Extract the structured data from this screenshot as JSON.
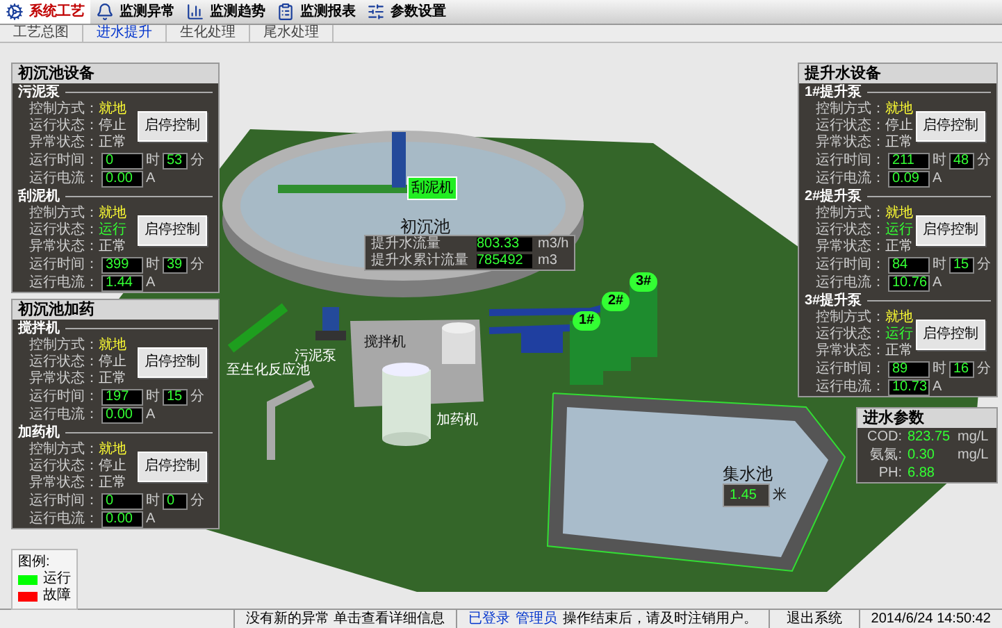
{
  "menu": [
    {
      "label": "系统工艺",
      "selected": true
    },
    {
      "label": "监测异常",
      "selected": false
    },
    {
      "label": "监测趋势",
      "selected": false
    },
    {
      "label": "监测报表",
      "selected": false
    },
    {
      "label": "参数设置",
      "selected": false
    }
  ],
  "subtabs": [
    {
      "label": "工艺总图",
      "selected": false
    },
    {
      "label": "进水提升",
      "selected": true
    },
    {
      "label": "生化处理",
      "selected": false
    },
    {
      "label": "尾水处理",
      "selected": false
    }
  ],
  "panels": [
    {
      "title": "初沉池设备",
      "groups": [
        {
          "name": "污泥泵",
          "button": "启停控制",
          "mode_label": "控制方式：",
          "mode": "就地",
          "status_label": "运行状态：",
          "status": "停止",
          "running": false,
          "fault_label": "异常状态：",
          "fault": "正常",
          "time_label": "运行时间：",
          "hours": "0",
          "hours_unit": "时",
          "minutes": "53",
          "minutes_unit": "分",
          "current_label": "运行电流：",
          "current": "0.00",
          "current_unit": "A"
        },
        {
          "name": "刮泥机",
          "button": "启停控制",
          "mode_label": "控制方式：",
          "mode": "就地",
          "status_label": "运行状态：",
          "status": "运行",
          "running": true,
          "fault_label": "异常状态：",
          "fault": "正常",
          "time_label": "运行时间：",
          "hours": "399",
          "hours_unit": "时",
          "minutes": "39",
          "minutes_unit": "分",
          "current_label": "运行电流：",
          "current": "1.44",
          "current_unit": "A"
        }
      ]
    },
    {
      "title": "初沉池加药",
      "groups": [
        {
          "name": "搅拌机",
          "button": "启停控制",
          "mode_label": "控制方式：",
          "mode": "就地",
          "status_label": "运行状态：",
          "status": "停止",
          "running": false,
          "fault_label": "异常状态：",
          "fault": "正常",
          "time_label": "运行时间：",
          "hours": "197",
          "hours_unit": "时",
          "minutes": "15",
          "minutes_unit": "分",
          "current_label": "运行电流：",
          "current": "0.00",
          "current_unit": "A"
        },
        {
          "name": "加药机",
          "button": "启停控制",
          "mode_label": "控制方式：",
          "mode": "就地",
          "status_label": "运行状态：",
          "status": "停止",
          "running": false,
          "fault_label": "异常状态：",
          "fault": "正常",
          "time_label": "运行时间：",
          "hours": "0",
          "hours_unit": "时",
          "minutes": "0",
          "minutes_unit": "分",
          "current_label": "运行电流：",
          "current": "0.00",
          "current_unit": "A"
        }
      ]
    },
    {
      "title": "提升水设备",
      "groups": [
        {
          "name": "1#提升泵",
          "button": "启停控制",
          "mode_label": "控制方式：",
          "mode": "就地",
          "status_label": "运行状态：",
          "status": "停止",
          "running": false,
          "fault_label": "异常状态：",
          "fault": "正常",
          "time_label": "运行时间：",
          "hours": "211",
          "hours_unit": "时",
          "minutes": "48",
          "minutes_unit": "分",
          "current_label": "运行电流：",
          "current": "0.09",
          "current_unit": "A"
        },
        {
          "name": "2#提升泵",
          "button": "启停控制",
          "mode_label": "控制方式：",
          "mode": "就地",
          "status_label": "运行状态：",
          "status": "运行",
          "running": true,
          "fault_label": "异常状态：",
          "fault": "正常",
          "time_label": "运行时间：",
          "hours": "84",
          "hours_unit": "时",
          "minutes": "15",
          "minutes_unit": "分",
          "current_label": "运行电流：",
          "current": "10.76",
          "current_unit": "A"
        },
        {
          "name": "3#提升泵",
          "button": "启停控制",
          "mode_label": "控制方式：",
          "mode": "就地",
          "status_label": "运行状态：",
          "status": "运行",
          "running": true,
          "fault_label": "异常状态：",
          "fault": "正常",
          "time_label": "运行时间：",
          "hours": "89",
          "hours_unit": "时",
          "minutes": "16",
          "minutes_unit": "分",
          "current_label": "运行电流：",
          "current": "10.73",
          "current_unit": "A"
        }
      ]
    }
  ],
  "inlet_params": {
    "title": "进水参数",
    "rows": [
      {
        "label": "COD:",
        "value": "823.75",
        "unit": "mg/L"
      },
      {
        "label": "氨氮:",
        "value": "0.30",
        "unit": "mg/L"
      },
      {
        "label": "PH:",
        "value": "6.88",
        "unit": ""
      }
    ]
  },
  "scene": {
    "tank_label": "初沉池",
    "scraper_tag": "刮泥机",
    "flow": [
      {
        "label": "提升水流量",
        "value": "803.33",
        "unit": "m3/h"
      },
      {
        "label": "提升水累计流量",
        "value": "785492",
        "unit": "m3"
      }
    ],
    "pumps": [
      "1#",
      "2#",
      "3#"
    ],
    "pool_label": "集水池",
    "pool_level": "1.45",
    "pool_unit": "米",
    "equipment_labels": [
      "污泥泵",
      "搅拌机",
      "加药机"
    ],
    "pipe_label": "至生化反应池"
  },
  "legend": {
    "title": "图例:",
    "items": [
      {
        "label": "运行",
        "color": "#00ff00"
      },
      {
        "label": "故障",
        "color": "#ff0000"
      }
    ]
  },
  "status_bar": {
    "alarm": "没有新的异常 单击查看详细信息",
    "login": "已登录",
    "login_user": "管理员",
    "login_hint": "操作结束后，请及时注销用户。",
    "logout": "退出系统",
    "datetime": "2014/6/24 14:50:42"
  }
}
